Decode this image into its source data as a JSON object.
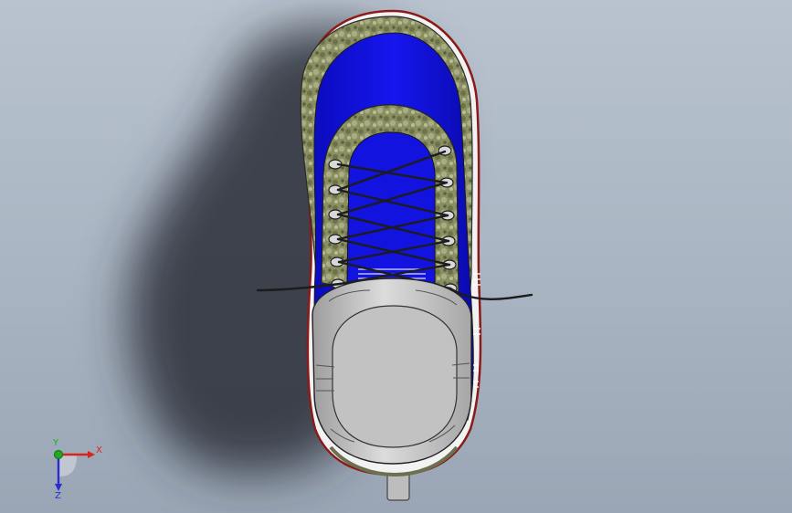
{
  "viewport": {
    "background_top": "#b9c3cf",
    "background_bottom": "#9aa6b5"
  },
  "model": {
    "upper_color": "#1414e6",
    "collar_color": "#8a8f62",
    "sole_color": "#c4c4c4",
    "lace_color": "#1c1c1c",
    "icons": [
      "shoe-model-icon",
      "lace-icon",
      "eyelet-icon"
    ]
  },
  "triad": {
    "x_label": "X",
    "y_label": "Y",
    "z_label": "Z",
    "x_color": "#d8241c",
    "y_color": "#1faa22",
    "z_color": "#2a2ad0"
  }
}
